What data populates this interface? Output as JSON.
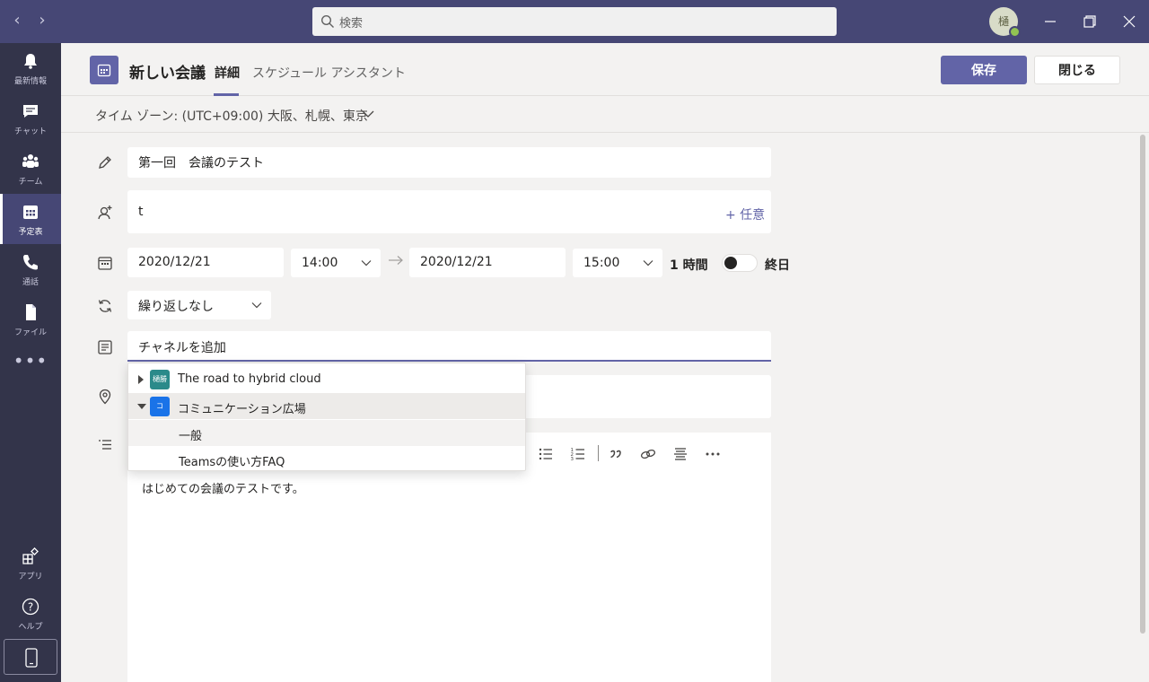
{
  "titlebar": {
    "search_placeholder": "検索",
    "avatar_initial": "樋"
  },
  "rail": {
    "items": [
      {
        "label": "最新情報",
        "icon": "bell-icon"
      },
      {
        "label": "チャット",
        "icon": "chat-icon"
      },
      {
        "label": "チーム",
        "icon": "teams-icon"
      },
      {
        "label": "予定表",
        "icon": "calendar-icon",
        "active": true
      },
      {
        "label": "通話",
        "icon": "phone-icon"
      },
      {
        "label": "ファイル",
        "icon": "file-icon"
      }
    ],
    "more": "•••",
    "apps_label": "アプリ",
    "help_label": "ヘルプ"
  },
  "header": {
    "title": "新しい会議",
    "tabs": [
      {
        "label": "詳細",
        "active": true
      },
      {
        "label": "スケジュール アシスタント",
        "active": false
      }
    ],
    "save_label": "保存",
    "close_label": "閉じる"
  },
  "timezone": {
    "label": "タイム ゾーン: (UTC+09:00) 大阪、札幌、東京"
  },
  "form": {
    "title_value": "第一回　会議のテスト",
    "attendees_value": "t",
    "optional_label": "+ 任意",
    "start_date": "2020/12/21",
    "start_time": "14:00",
    "end_date": "2020/12/21",
    "end_time": "15:00",
    "duration": "1 時間",
    "allday_label": "終日",
    "allday_on": false,
    "repeat_value": "繰り返しなし",
    "channel_placeholder": "チャネルを追加"
  },
  "dropdown": {
    "teams": [
      {
        "name": "The road to hybrid cloud",
        "badge": "樋勝",
        "color": "#2b8a8a",
        "expanded": false
      },
      {
        "name": "コミュニケーション広場",
        "badge": "コ",
        "color": "#1a73e8",
        "expanded": true
      }
    ],
    "channels": [
      "一般",
      "Teamsの使い方FAQ"
    ]
  },
  "editor": {
    "body_text": "はじめての会議のテストです。"
  },
  "colors": {
    "accent": "#6264a7",
    "titlebar": "#464775",
    "rail": "#33344a"
  }
}
